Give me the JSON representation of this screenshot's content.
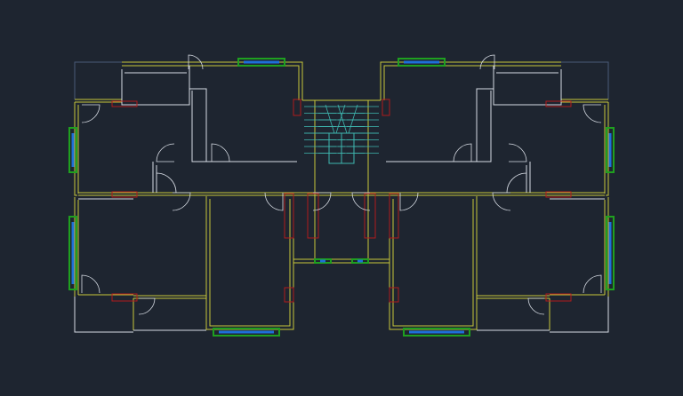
{
  "drawing": {
    "background": "#1e2530",
    "layers": {
      "walls": "#c8c83a",
      "partitions": "#d6dbe3",
      "window_frame": "#1fa01f",
      "window_glass": "#1e6fd9",
      "columns": "#b01c1c",
      "stairs": "#3fb8b0",
      "outline": "#4a5a78",
      "door": "#d6dbe3"
    }
  }
}
